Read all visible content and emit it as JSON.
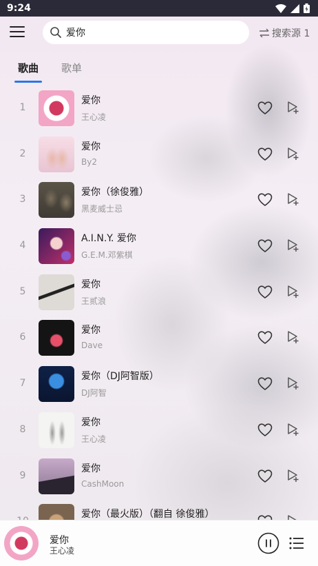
{
  "status": {
    "time": "9:24"
  },
  "search": {
    "query": "爱你"
  },
  "header": {
    "source_label": "搜索源 1"
  },
  "tabs": [
    {
      "label": "歌曲"
    },
    {
      "label": "歌单"
    }
  ],
  "songs": [
    {
      "index": "1",
      "title": "爱你",
      "artist": "王心凌"
    },
    {
      "index": "2",
      "title": "爱你",
      "artist": "By2"
    },
    {
      "index": "3",
      "title": "爱你（徐俊雅）",
      "artist": "黑麦威士忌"
    },
    {
      "index": "4",
      "title": "A.I.N.Y. 爱你",
      "artist": "G.E.M.邓紫棋"
    },
    {
      "index": "5",
      "title": "爱你",
      "artist": "王贰浪"
    },
    {
      "index": "6",
      "title": "爱你",
      "artist": "Dave"
    },
    {
      "index": "7",
      "title": "爱你（DJ阿智版）",
      "artist": "DJ阿智"
    },
    {
      "index": "8",
      "title": "爱你",
      "artist": "王心凌"
    },
    {
      "index": "9",
      "title": "爱你",
      "artist": "CashMoon"
    },
    {
      "index": "10",
      "title": "爱你（最火版）（翻自 徐俊雅）",
      "artist": ""
    }
  ],
  "player": {
    "title": "爱你",
    "artist": "王心凌"
  },
  "colors": {
    "accent": "#2b77e8",
    "status_bar": "#2b2a38"
  }
}
